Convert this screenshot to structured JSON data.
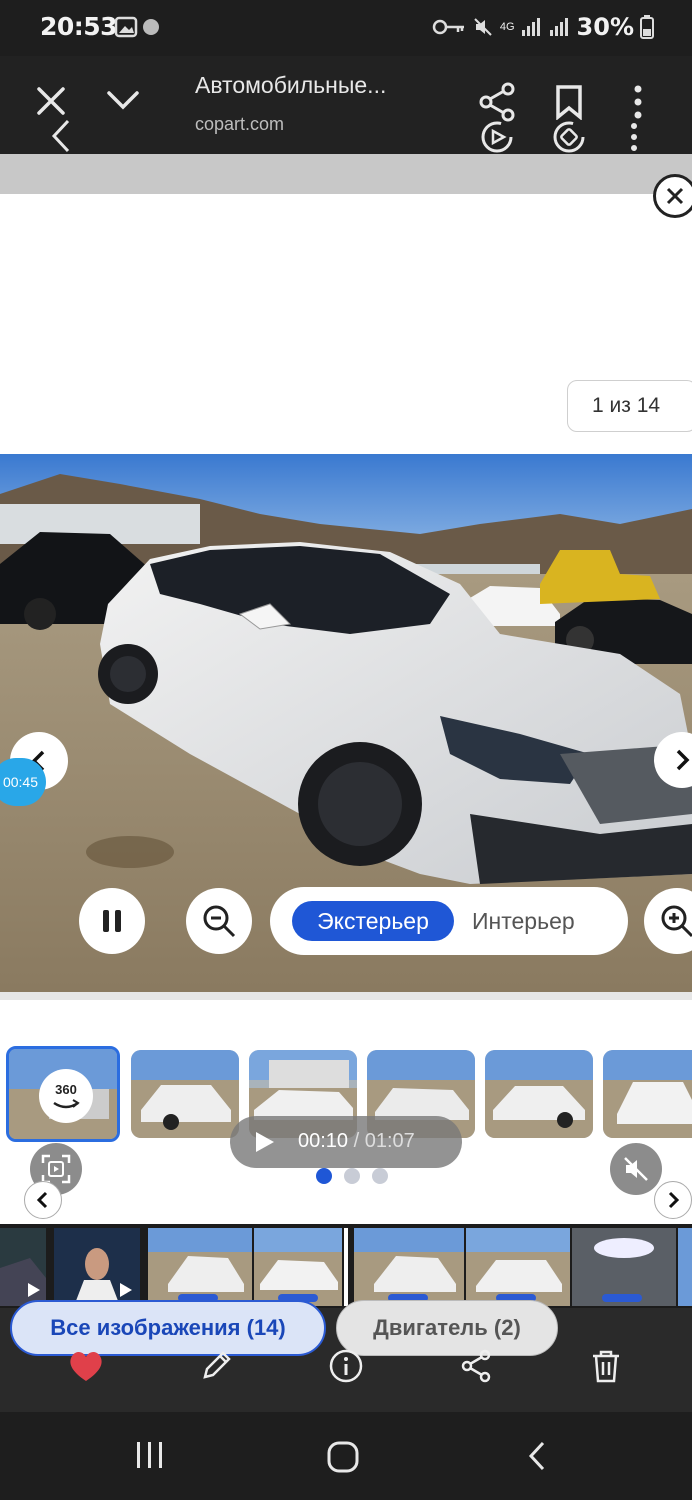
{
  "status_bar": {
    "time": "20:53",
    "network": "4G",
    "battery": "30%"
  },
  "browser": {
    "title": "Автомобильные...",
    "url": "copart.com"
  },
  "viewer": {
    "counter": "1 из 14",
    "timer": "00:45",
    "toggle_active": "Экстерьер",
    "toggle_inactive": "Интерьер",
    "badge_360": "360"
  },
  "video": {
    "current_time": "00:10",
    "separator": " / ",
    "total_time": "01:07"
  },
  "chips": {
    "all_images": "Все изображения (14)",
    "engine": "Двигатель (2)"
  },
  "colors": {
    "accent": "#1f57d6",
    "timer": "#29a7e8",
    "heart": "#e0404a"
  }
}
